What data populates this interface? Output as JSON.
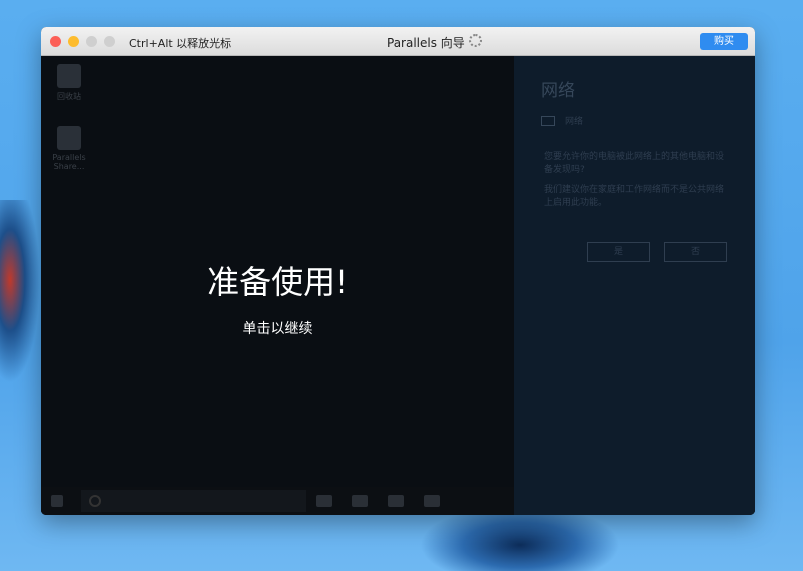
{
  "window": {
    "mouse_hint": "Ctrl+Alt 以释放光标",
    "title": "Parallels 向导",
    "buy_label": "购买"
  },
  "desktop": {
    "icons": [
      {
        "label": "回收站"
      },
      {
        "label": "Parallels Share..."
      }
    ]
  },
  "overlay": {
    "heading": "准备使用!",
    "subtext": "单击以继续"
  },
  "network_panel": {
    "title": "网络",
    "network_name": "网络",
    "question": "您要允许你的电脑被此网络上的其他电脑和设备发现吗?",
    "recommendation": "我们建议你在家庭和工作网络而不是公共网络上启用此功能。",
    "yes_label": "是",
    "no_label": "否"
  },
  "colors": {
    "close": "#fc5f57",
    "minimize": "#fdbc2e",
    "buy": "#2f8cf0"
  }
}
